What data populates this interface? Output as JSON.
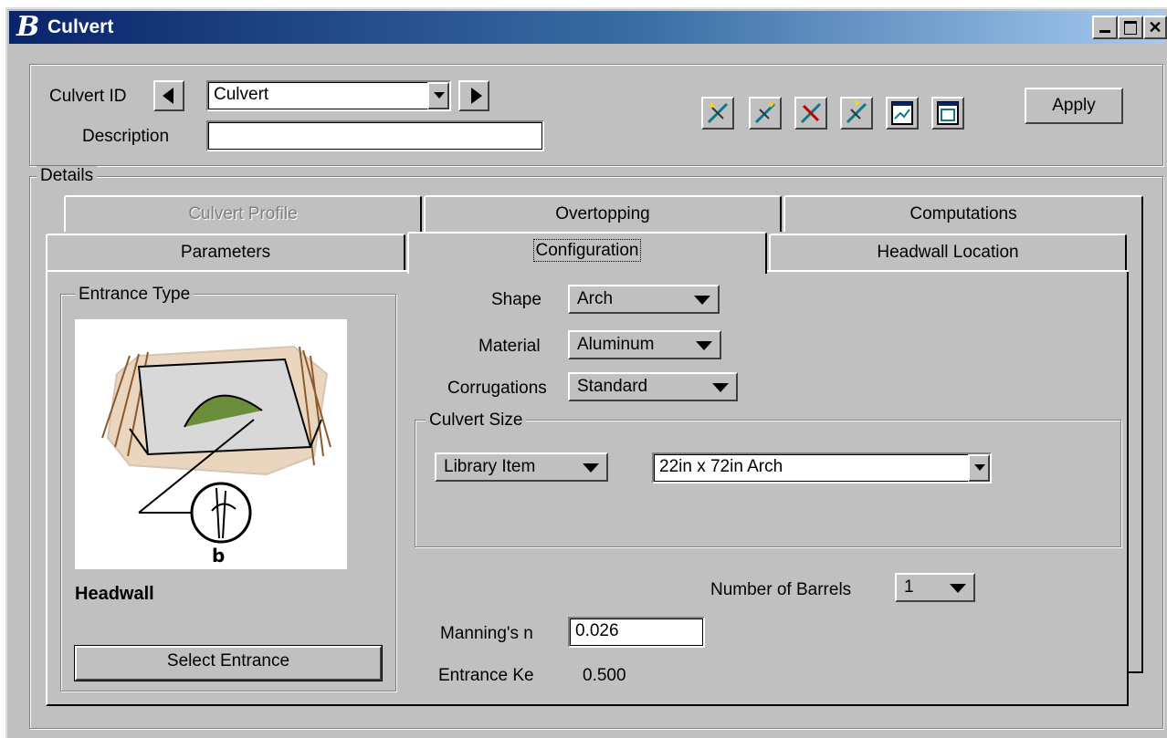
{
  "window": {
    "title": "Culvert"
  },
  "header": {
    "culvert_id_label": "Culvert ID",
    "culvert_id_value": "Culvert",
    "description_label": "Description",
    "description_value": "",
    "apply_label": "Apply",
    "toolbar_icons": [
      "new-culvert-icon",
      "copy-culvert-icon",
      "delete-culvert-icon",
      "rename-culvert-icon",
      "report-icon",
      "graph-icon"
    ]
  },
  "details": {
    "label": "Details",
    "tabs_back": [
      "Culvert Profile",
      "Overtopping",
      "Computations"
    ],
    "tabs_front": [
      "Parameters",
      "Configuration",
      "Headwall Location"
    ],
    "active_tab": "Configuration"
  },
  "entrance": {
    "group_label": "Entrance Type",
    "image_label": "b",
    "type_name": "Headwall",
    "select_label": "Select Entrance"
  },
  "config": {
    "shape_label": "Shape",
    "shape_value": "Arch",
    "material_label": "Material",
    "material_value": "Aluminum",
    "corrugations_label": "Corrugations",
    "corrugations_value": "Standard",
    "size_group_label": "Culvert Size",
    "size_mode_value": "Library Item",
    "size_value": "22in x 72in Arch",
    "barrels_label": "Number of Barrels",
    "barrels_value": "1",
    "mannings_label": "Manning's n",
    "mannings_value": "0.026",
    "ke_label": "Entrance Ke",
    "ke_value": "0.500"
  },
  "colors": {
    "titlebar_start": "#0a246a",
    "titlebar_end": "#a6caf0",
    "face": "#c0c0c0"
  }
}
